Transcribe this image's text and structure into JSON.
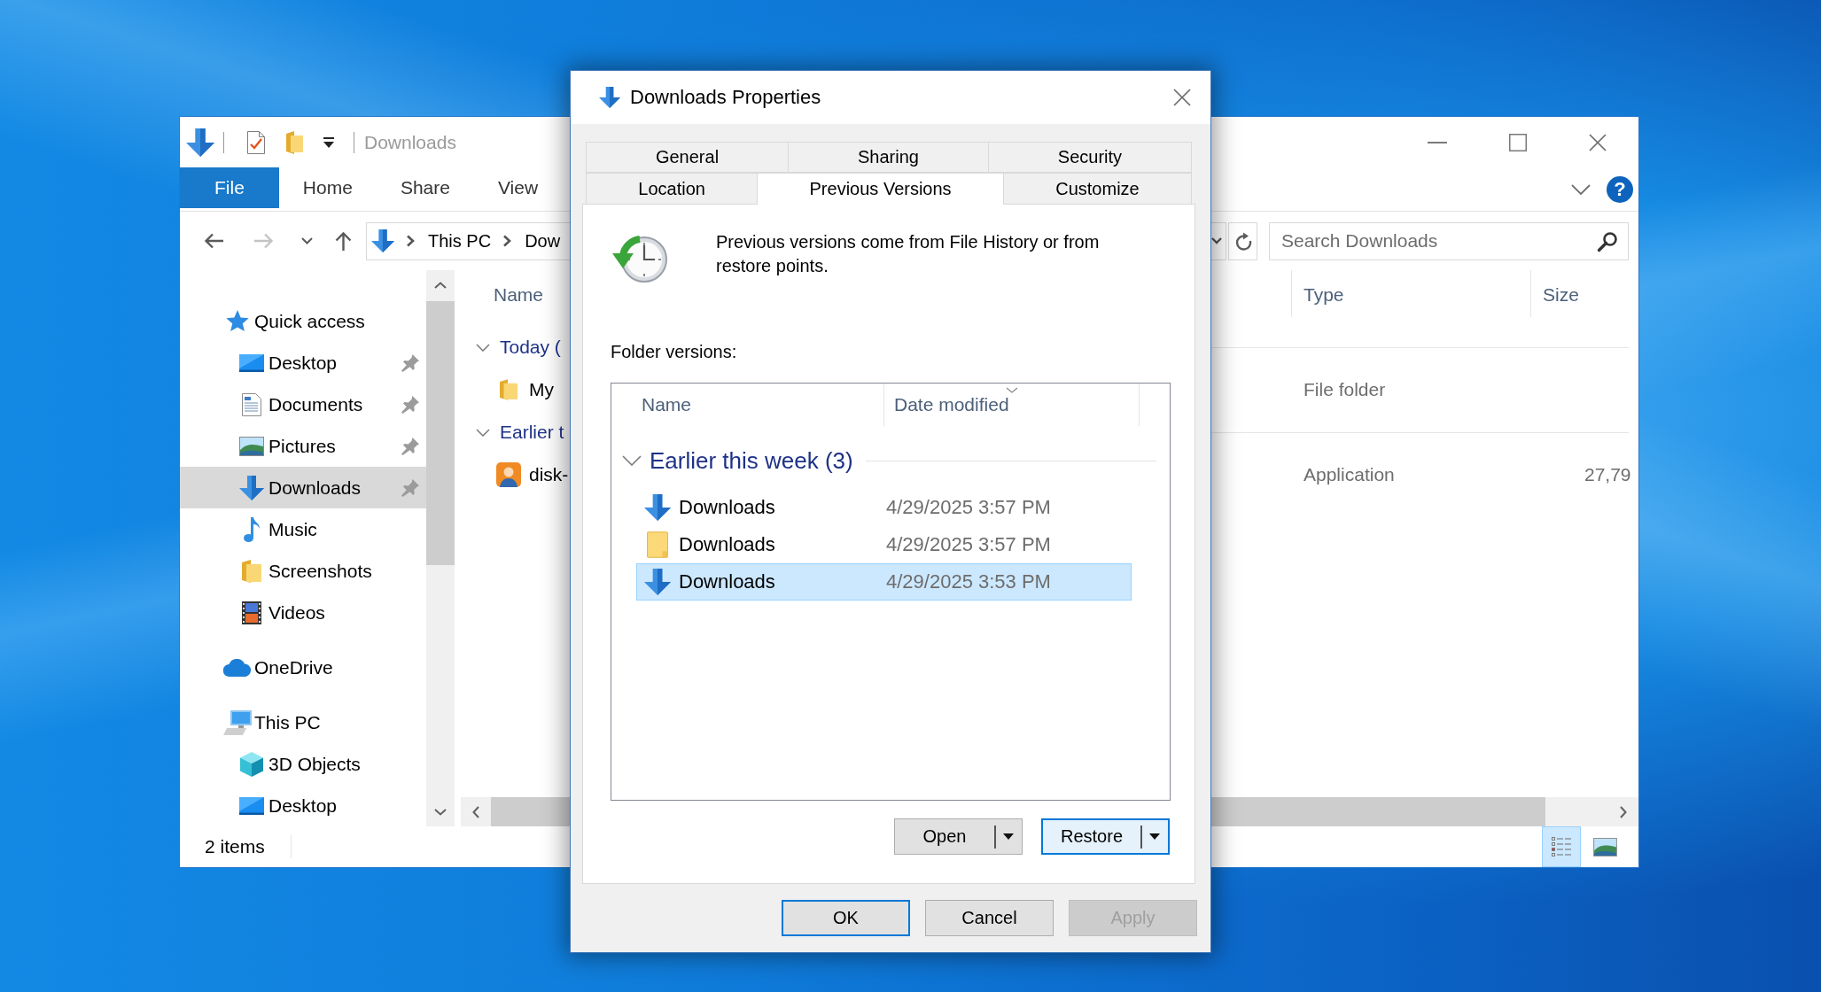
{
  "explorer": {
    "title": "Downloads",
    "ribbon_tabs": [
      {
        "label": "File",
        "kind": "menu"
      },
      {
        "label": "Home",
        "kind": "tab"
      },
      {
        "label": "Share",
        "kind": "tab"
      },
      {
        "label": "View",
        "kind": "tab"
      }
    ],
    "help": "?",
    "nav_buttons": [
      {
        "kind": "back",
        "disabled": false
      },
      {
        "kind": "forward",
        "disabled": true
      },
      {
        "kind": "recent",
        "disabled": false
      },
      {
        "kind": "up",
        "disabled": false
      }
    ],
    "address": {
      "crumbs": [
        "This PC",
        "Dow"
      ]
    },
    "search": {
      "placeholder": "Search Downloads"
    },
    "nav_tree": [
      {
        "label": "Quick access",
        "kind": "star",
        "pinned": false,
        "selected": false,
        "children": [
          {
            "label": "Desktop",
            "kind": "desktop",
            "pinned": true,
            "selected": false
          },
          {
            "label": "Documents",
            "kind": "documents",
            "pinned": true,
            "selected": false
          },
          {
            "label": "Pictures",
            "kind": "pictures",
            "pinned": true,
            "selected": false
          },
          {
            "label": "Downloads",
            "kind": "downloads",
            "pinned": true,
            "selected": true
          },
          {
            "label": "Music",
            "kind": "music",
            "pinned": false,
            "selected": false
          },
          {
            "label": "Screenshots",
            "kind": "folder",
            "pinned": false,
            "selected": false
          },
          {
            "label": "Videos",
            "kind": "videos",
            "pinned": false,
            "selected": false
          }
        ]
      },
      {
        "label": "OneDrive",
        "kind": "cloud",
        "pinned": false,
        "selected": false
      },
      {
        "label": "This PC",
        "kind": "computer",
        "pinned": false,
        "selected": false,
        "children": [
          {
            "label": "3D Objects",
            "kind": "cube",
            "pinned": false,
            "selected": false
          },
          {
            "label": "Desktop",
            "kind": "desktop",
            "pinned": false,
            "selected": false
          }
        ]
      }
    ],
    "columns": [
      "Name",
      "Type",
      "Size"
    ],
    "groups": [
      {
        "title": "Today (",
        "expanded": true,
        "items": [
          {
            "name": "My",
            "kind": "folder",
            "type": "File folder"
          }
        ]
      },
      {
        "title": "Earlier t",
        "expanded": true,
        "items": [
          {
            "name": "disk-",
            "kind": "app",
            "type": "Application",
            "size": "27,79"
          }
        ]
      }
    ],
    "status_bar": {
      "count": "2 items",
      "views": [
        {
          "kind": "details",
          "selected": true
        },
        {
          "kind": "thumbnails",
          "selected": false
        }
      ]
    }
  },
  "dialog": {
    "title": "Downloads Properties",
    "tab_rows": [
      {
        "tabs": [
          {
            "label": "General",
            "selected": false
          },
          {
            "label": "Sharing",
            "selected": false
          },
          {
            "label": "Security",
            "selected": false
          }
        ]
      },
      {
        "tabs": [
          {
            "label": "Location",
            "selected": false
          },
          {
            "label": "Previous Versions",
            "selected": true
          },
          {
            "label": "Customize",
            "selected": false
          }
        ]
      }
    ],
    "info": "Previous versions come from File History or from restore points.",
    "list_label": "Folder versions:",
    "columns": [
      {
        "label": "Name",
        "sorted": false
      },
      {
        "label": "Date modified",
        "sorted": true
      }
    ],
    "groups": [
      {
        "title": "Earlier this week (3)",
        "expanded": true,
        "items": [
          {
            "name": "Downloads",
            "kind": "downloads",
            "date": "4/29/2025 3:57 PM",
            "selected": false
          },
          {
            "name": "Downloads",
            "kind": "folder",
            "date": "4/29/2025 3:57 PM",
            "selected": false
          },
          {
            "name": "Downloads",
            "kind": "downloads",
            "date": "4/29/2025 3:53 PM",
            "selected": true
          }
        ]
      }
    ],
    "actions": [
      {
        "label": "Open",
        "focused": false
      },
      {
        "label": "Restore",
        "focused": true
      }
    ],
    "buttons": [
      {
        "label": "OK",
        "default": true,
        "disabled": false
      },
      {
        "label": "Cancel",
        "default": false,
        "disabled": false
      },
      {
        "label": "Apply",
        "default": false,
        "disabled": true
      }
    ]
  }
}
